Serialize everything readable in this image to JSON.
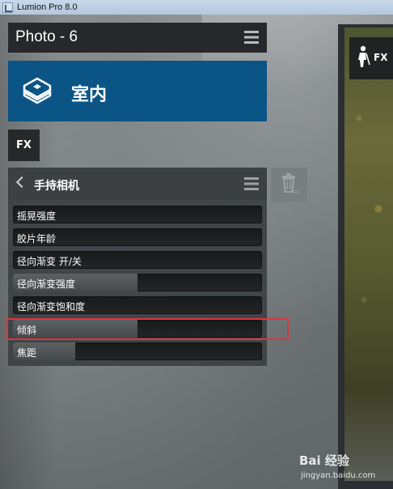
{
  "window": {
    "title": "Lumion Pro 8.0"
  },
  "photo_header": {
    "name": "Photo - 6"
  },
  "scene_card": {
    "label": "室内"
  },
  "fx_button": {
    "label": "FX"
  },
  "fx_tool": {
    "label": "FX"
  },
  "effect": {
    "name": "手持相机",
    "sliders": [
      {
        "label": "摇晃强度",
        "level_percent": 0
      },
      {
        "label": "胶片年龄",
        "level_percent": 0
      },
      {
        "label": "径向渐变 开/关",
        "level_percent": 0
      },
      {
        "label": "径向渐变强度",
        "level_percent": 50
      },
      {
        "label": "径向渐变饱和度",
        "level_percent": 0
      },
      {
        "label": "倾斜",
        "level_percent": 50
      },
      {
        "label": "焦距",
        "level_percent": 25
      }
    ],
    "highlighted_slider": "倾斜"
  },
  "icons": {
    "app": "lumion-app-icon",
    "scene": "cube-icon",
    "menu": "hamburger-menu-icon",
    "back": "chevron-left-icon",
    "delete": "trash-icon",
    "fx_person": "person-shovel-icon"
  },
  "colors": {
    "scene_card": "#0b5486",
    "highlight": "#e0353b",
    "panel_dark": "#262829"
  },
  "watermark": {
    "main": "Bai 经验",
    "sub": "jingyan.baidu.com"
  }
}
